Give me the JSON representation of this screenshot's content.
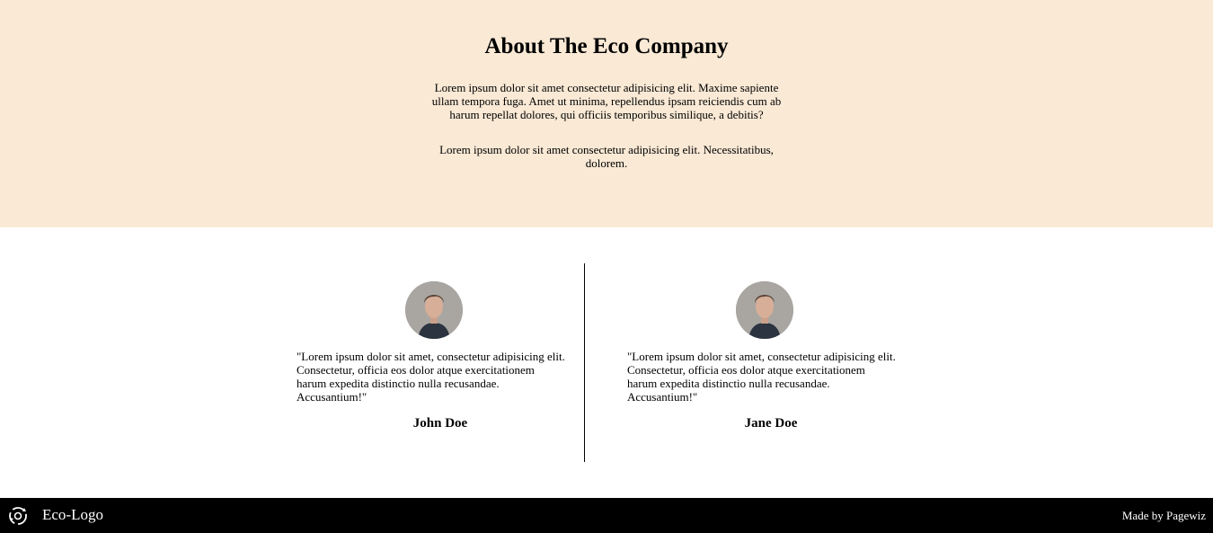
{
  "about": {
    "title": "About The Eco Company",
    "paragraph1": "Lorem ipsum dolor sit amet consectetur adipisicing elit. Maxime sapiente ullam tempora fuga. Amet ut minima, repellendus ipsam reiciendis cum ab harum repellat dolores, qui officiis temporibus similique, a debitis?",
    "paragraph2": "Lorem ipsum dolor sit amet consectetur adipisicing elit. Necessitatibus, dolorem.",
    "background_color": "#f9e9d5"
  },
  "testimonials": [
    {
      "quote": "\"Lorem ipsum dolor sit amet, consectetur adipisicing elit. Consectetur, officia eos dolor atque exercitationem harum expedita distinctio nulla recusandae. Accusantium!\"",
      "name": "John Doe",
      "avatar_icon": "person-photo"
    },
    {
      "quote": "\"Lorem ipsum dolor sit amet, consectetur adipisicing elit. Consectetur, officia eos dolor atque exercitationem harum expedita distinctio nulla recusandae. Accusantium!\"",
      "name": "Jane Doe",
      "avatar_icon": "person-photo"
    }
  ],
  "footer": {
    "logo_icon": "eco-recycle-icon",
    "logo_text": "Eco-Logo",
    "made_by": "Made by Pagewiz",
    "background_color": "#000000"
  }
}
